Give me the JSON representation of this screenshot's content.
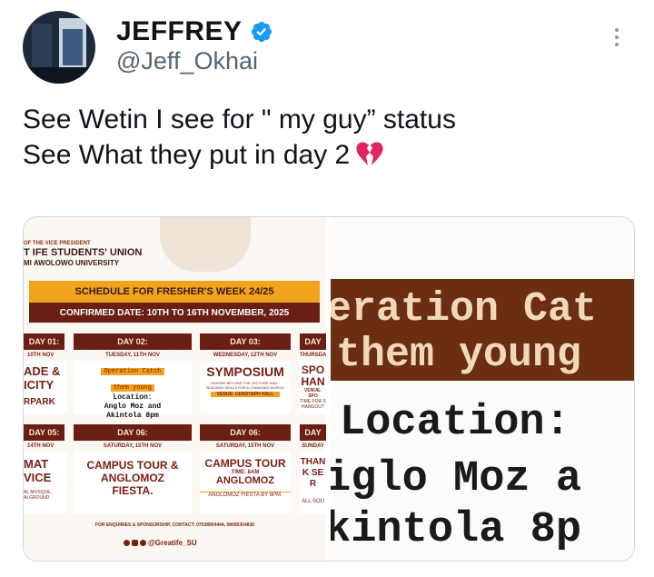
{
  "user": {
    "name": "JEFFREY",
    "handle": "@Jeff_Okhai"
  },
  "tweet": {
    "line1": "See Wetin I see for  \" my guy” status",
    "line2": "See What they put in day 2"
  },
  "colors": {
    "verified": "#1d9bf0",
    "handle_gray": "#536471",
    "poster_orange": "#f2a31c",
    "poster_maroon": "#6b1f14",
    "broken_heart": "#e0245e"
  },
  "poster": {
    "office": "OF THE VICE PRESIDENT",
    "union": "T IFE STUDENTS' UNION",
    "university": "MI AWOLOWO UNIVERSITY",
    "schedule_title": "SCHEDULE FOR FRESHER'S WEEK 24/25",
    "confirmed": "CONFIRMED DATE: 10TH TO 16TH NOVEMBER, 2025",
    "days_row1": [
      {
        "label": "DAY 01:",
        "date": "10TH NOV",
        "event": "ADE & ICITY",
        "sub": "RPARK"
      },
      {
        "label": "DAY 02:",
        "date": "TUESDAY, 11TH NOV",
        "event_tag1": "Operation Catch",
        "event_tag2": "them young",
        "loc1": "Location:",
        "loc2": "Anglo Moz and",
        "loc3": "Akintola 8pm"
      },
      {
        "label": "DAY 03:",
        "date": "WEDNESDAY, 12TH NOV",
        "event": "SYMPOSIUM",
        "venue": "VENUE: CENOTAPH HALL",
        "desc": "MOVING BEYOND THE LECTURE HALL: BUILDING SKILLS FOR A CHANGING WORLD"
      },
      {
        "label": "DAY",
        "date": "THURSDA",
        "event": "SPO HAN",
        "venue": "VENUE: SPO",
        "time": "TIME FOR S HANGOUT"
      }
    ],
    "days_row2": [
      {
        "label": "DAY 05:",
        "date": "14TH NOV",
        "event": "MAT VICE",
        "sub": "AL MOSQUE, ALGROUND"
      },
      {
        "label": "DAY 06:",
        "date": "SATURDAY, 15TH NOV",
        "event": "CAMPUS TOUR & ANGLOMOZ FIESTA."
      },
      {
        "label": "DAY 06:",
        "date": "SATURDAY, 15TH NOV",
        "event": "CAMPUS TOUR",
        "time": "TIME: 8AM",
        "venue": "ANGLOMOZ",
        "sub": "ANGLOMOZ FIESTA BY 6PM."
      },
      {
        "label": "DAY",
        "date": "SUNDAY",
        "event": "THANK SER",
        "sub": "ALL SOU"
      }
    ],
    "contact": "FOR ENQUIRIES & SPONSORSHIP, CONTACT: 07038954444, 08085304836",
    "social": "@Greatife_SU"
  },
  "zoom": {
    "line1": "eration Cat",
    "line2": "them young",
    "line3": "Location:",
    "line4": "iglo Moz a",
    "line5": "kintola 8p"
  }
}
